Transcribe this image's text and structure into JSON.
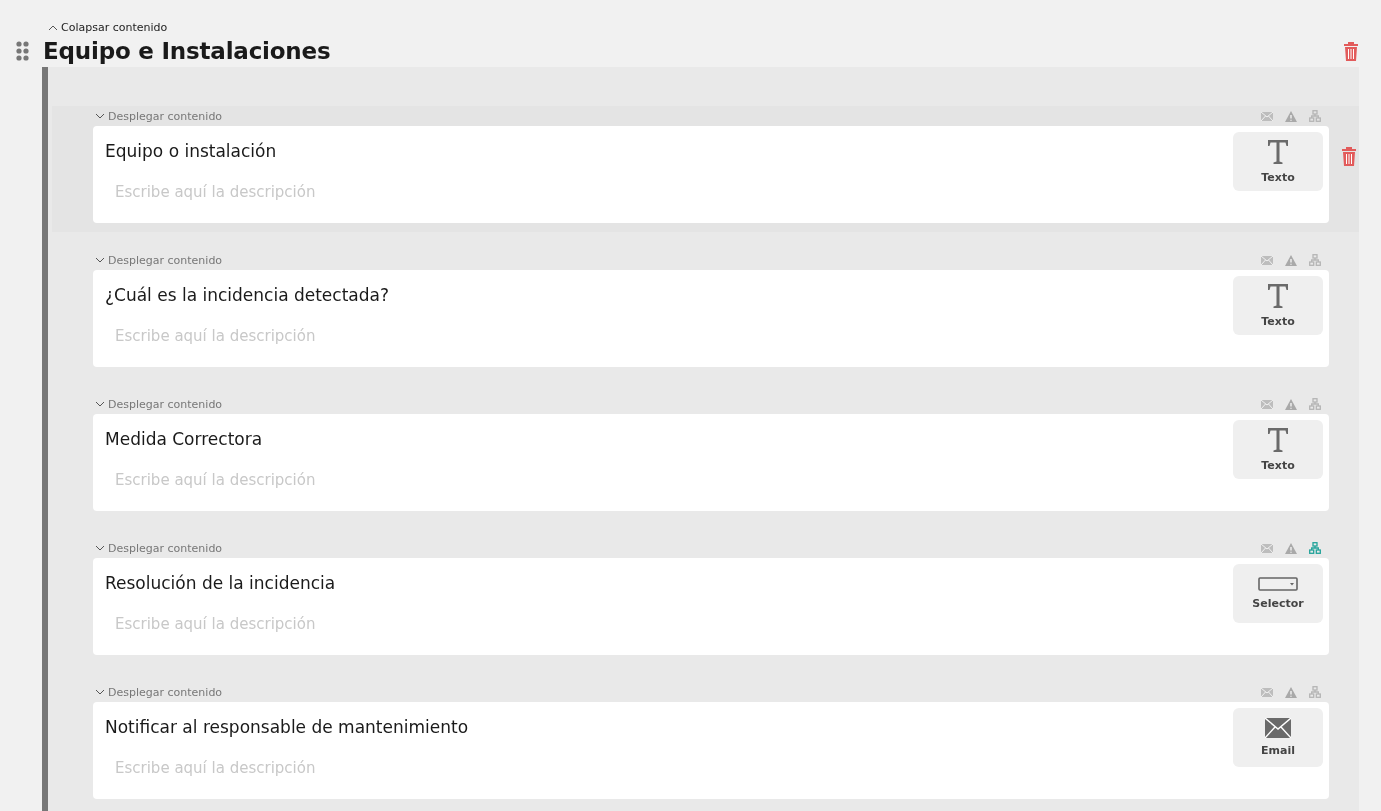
{
  "section": {
    "collapse_label": "Colapsar contenido",
    "title": "Equipo e Instalaciones"
  },
  "items": [
    {
      "expand_label": "Desplegar contenido",
      "title": "Equipo o instalación",
      "placeholder": "Escribe aquí la descripción",
      "type": {
        "kind": "text",
        "label": "Texto"
      },
      "branch_active": false,
      "hovered": true
    },
    {
      "expand_label": "Desplegar contenido",
      "title": "¿Cuál es la incidencia detectada?",
      "placeholder": "Escribe aquí la descripción",
      "type": {
        "kind": "text",
        "label": "Texto"
      },
      "branch_active": false,
      "hovered": false
    },
    {
      "expand_label": "Desplegar contenido",
      "title": "Medida Correctora",
      "placeholder": "Escribe aquí la descripción",
      "type": {
        "kind": "text",
        "label": "Texto"
      },
      "branch_active": false,
      "hovered": false
    },
    {
      "expand_label": "Desplegar contenido",
      "title": "Resolución de la incidencia",
      "placeholder": "Escribe aquí la descripción",
      "type": {
        "kind": "selector",
        "label": "Selector"
      },
      "branch_active": true,
      "hovered": false
    },
    {
      "expand_label": "Desplegar contenido",
      "title": "Notificar al responsable de mantenimiento",
      "placeholder": "Escribe aquí la descripción",
      "type": {
        "kind": "email",
        "label": "Email"
      },
      "branch_active": false,
      "hovered": false
    }
  ]
}
